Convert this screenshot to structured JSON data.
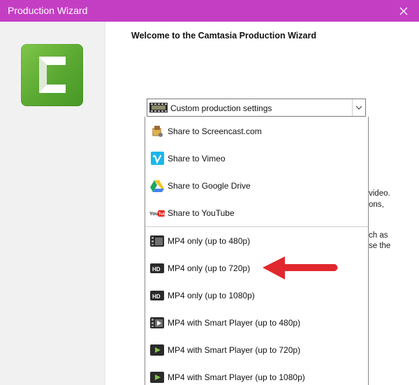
{
  "window": {
    "title": "Production Wizard",
    "close_glyph": "✕"
  },
  "main": {
    "welcome": "Welcome to the Camtasia Production Wizard",
    "bg_fragments": [
      "video.",
      "ons,",
      "ch as",
      "se the"
    ]
  },
  "combo": {
    "selected": "Custom production settings"
  },
  "dropdown": {
    "items": [
      {
        "label": "Share to Screencast.com",
        "icon": "screencast-icon"
      },
      {
        "label": "Share to Vimeo",
        "icon": "vimeo-icon"
      },
      {
        "label": "Share to Google Drive",
        "icon": "google-drive-icon"
      },
      {
        "label": "Share to YouTube",
        "icon": "youtube-icon"
      },
      {
        "label": "MP4 only (up to 480p)",
        "icon": "film-icon"
      },
      {
        "label": "MP4 only (up to 720p)",
        "icon": "hd-icon"
      },
      {
        "label": "MP4 only (up to 1080p)",
        "icon": "hd-icon"
      },
      {
        "label": "MP4 with Smart Player (up to 480p)",
        "icon": "film-play-icon"
      },
      {
        "label": "MP4 with Smart Player (up to 720p)",
        "icon": "play-icon"
      },
      {
        "label": "MP4 with Smart Player (up to 1080p)",
        "icon": "play-icon"
      }
    ]
  },
  "colors": {
    "titlebar": "#c43ec4",
    "logo_green": "#5aa832",
    "annotation_red": "#e0282e"
  }
}
